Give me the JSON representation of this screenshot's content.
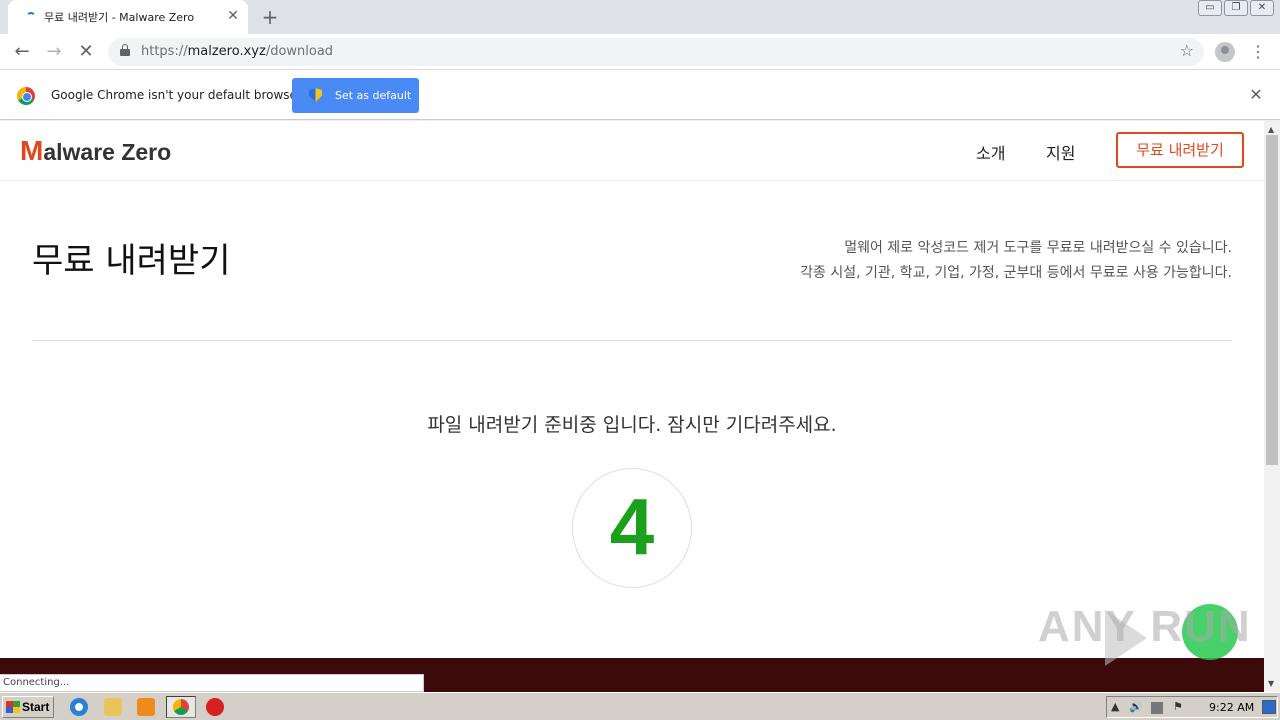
{
  "browser": {
    "tab_title": "무료 내려받기 - Malware Zero",
    "tab_close": "✕",
    "new_tab": "+",
    "window_controls": [
      "▭",
      "❐",
      "✕"
    ],
    "nav_back": "←",
    "nav_forward": "→",
    "nav_stop": "✕",
    "url_prefix": "https://",
    "url_host": "malzero.xyz",
    "url_path": "/download",
    "star": "☆",
    "menu": "⋮",
    "infobar_text": "Google Chrome isn't your default browser",
    "infobar_button": "Set as default",
    "infobar_close": "✕",
    "status_text": "Connecting..."
  },
  "site": {
    "logo_m": "M",
    "logo_rest": "alware ",
    "logo_zero": "Zero",
    "nav": [
      "소개",
      "지원"
    ],
    "cta": "무료 내려받기",
    "heading": "무료 내려받기",
    "desc_line1": "멀웨어 제로 악성코드 제거 도구를 무료로 내려받으실 수 있습니다.",
    "desc_line2": "각종 시설, 기관, 학교, 기업, 가정, 군부대 등에서 무료로 사용 가능합니다.",
    "wait_message": "파일 내려받기 준비중 입니다. 잠시만 기다려주세요.",
    "countdown": "4",
    "accent_color": "#e1471d",
    "counter_color": "#1aa01a",
    "footer_color": "#3d0a0c"
  },
  "watermark": {
    "text": "ANY  RUN"
  },
  "taskbar": {
    "start_label": "Start",
    "clock": "9:22 AM",
    "tray_icons": [
      "▲",
      "🔊",
      "⚑"
    ]
  }
}
